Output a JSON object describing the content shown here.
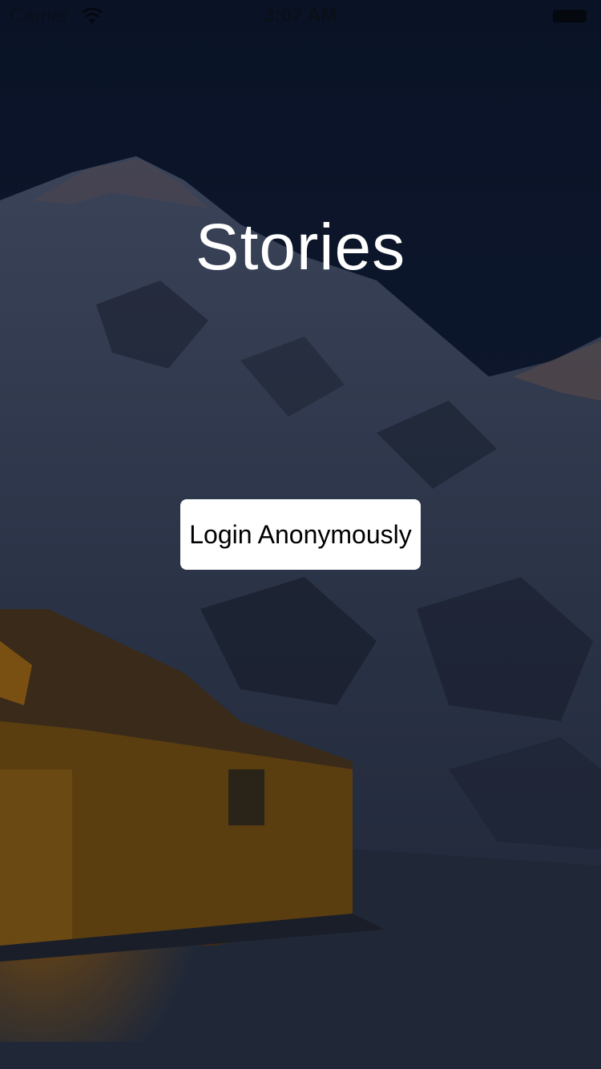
{
  "status_bar": {
    "carrier": "Carrier",
    "time": "3:07 AM",
    "wifi_icon": "wifi-icon",
    "battery_icon": "battery-icon"
  },
  "background": {
    "subject": "snowy mountain with a lit tent at night",
    "colors": {
      "sky": "#0c1830",
      "snow": "#2e3b52",
      "tent": "#6e4a10"
    }
  },
  "app": {
    "title": "Stories"
  },
  "actions": {
    "login_label": "Login Anonymously"
  }
}
